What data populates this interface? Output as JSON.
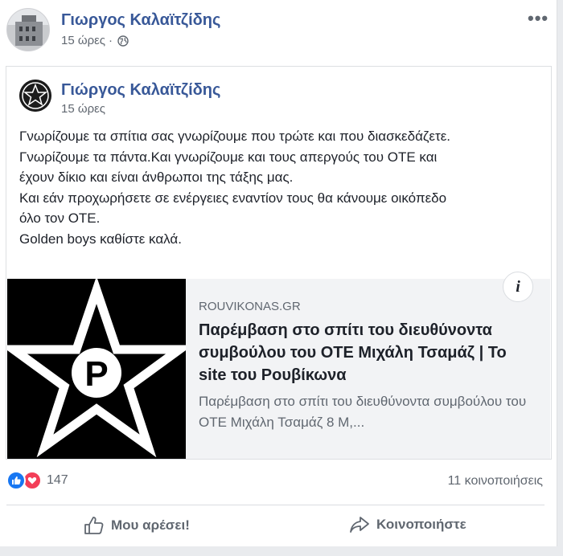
{
  "post": {
    "author": "Γιωργος Καλαϊτζίδης",
    "time": "15 ώρες",
    "separator": "·"
  },
  "shared_post": {
    "author": "Γιώργος Καλαϊτζίδης",
    "time": "15 ώρες",
    "lines": [
      "Γνωρίζουμε τα σπίτια σας γνωρίζουμε που τρώτε και που διασκεδάζετε.",
      "Γνωρίζουμε τα πάντα.Και γνωρίζουμε και τους απεργούς του ΟΤΕ και",
      "έχουν δίκιο και είναι άνθρωποι της τάξης μας.",
      "Και εάν προχωρήσετε σε ενέργειες εναντίον τους θα κάνουμε οικόπεδο",
      "όλο τον ΟΤΕ.",
      "Golden boys καθίστε καλά."
    ]
  },
  "link_preview": {
    "domain": "ROUVIKONAS.GR",
    "title": "Παρέμβαση στο σπίτι του διευθύνοντα συμβούλου του ΟΤΕ Μιχάλη Τσαμάζ | Το site του Ρουβίκωνα",
    "description": "Παρέμβαση στο σπίτι του διευθύνοντα συμβούλου του ΟΤΕ Μιχάλη Τσαμάζ 8 Μ,...",
    "info_glyph": "i",
    "image_letter": "P"
  },
  "engagement": {
    "reaction_count": "147",
    "shares": "11 κοινοποιήσεις"
  },
  "actions": {
    "like": "Μου αρέσει!",
    "share": "Κοινοποιήστε"
  },
  "icons": {
    "more": "more-horizontal-icon",
    "globe": "globe-icon",
    "like": "thumbs-up-icon",
    "love": "heart-icon",
    "share": "share-arrow-icon"
  },
  "colors": {
    "name_link": "#385898",
    "like_blue": "#1877f2",
    "love_red": "#f33e58"
  }
}
